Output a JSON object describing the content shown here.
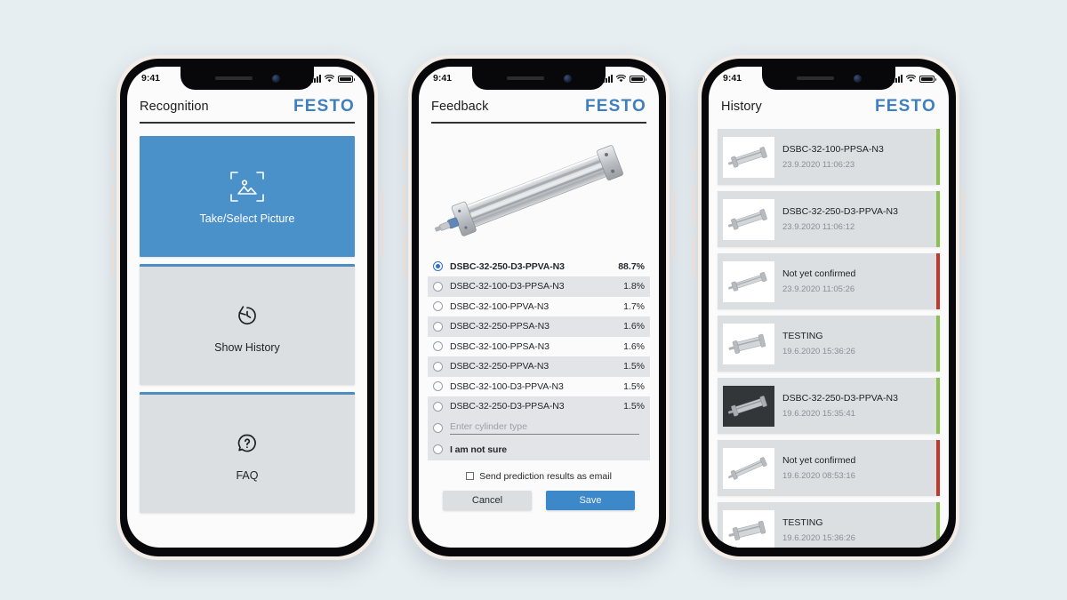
{
  "colors": {
    "background": "#e7eef2",
    "brand_blue": "#3f7fbf",
    "tile_blue": "#4a90c9",
    "tile_gray": "#dcdfe1",
    "save_blue": "#3d88c8",
    "status_ok": "#8cc152",
    "status_error": "#c0392b"
  },
  "status_bar": {
    "time": "9:41"
  },
  "brand": {
    "logo": "FESTO"
  },
  "screen_recognition": {
    "title": "Recognition",
    "tiles": [
      {
        "label": "Take/Select Picture",
        "icon": "image-scan-icon"
      },
      {
        "label": "Show History",
        "icon": "history-clock-icon"
      },
      {
        "label": "FAQ",
        "icon": "question-bubble-icon"
      }
    ]
  },
  "screen_feedback": {
    "title": "Feedback",
    "hero_image_alt": "pneumatic-cylinder-photo",
    "predictions": [
      {
        "name": "DSBC-32-250-D3-PPVA-N3",
        "confidence": "88.7%",
        "selected": true
      },
      {
        "name": "DSBC-32-100-D3-PPSA-N3",
        "confidence": "1.8%",
        "selected": false
      },
      {
        "name": "DSBC-32-100-PPVA-N3",
        "confidence": "1.7%",
        "selected": false
      },
      {
        "name": "DSBC-32-250-PPSA-N3",
        "confidence": "1.6%",
        "selected": false
      },
      {
        "name": "DSBC-32-100-PPSA-N3",
        "confidence": "1.6%",
        "selected": false
      },
      {
        "name": "DSBC-32-250-PPVA-N3",
        "confidence": "1.5%",
        "selected": false
      },
      {
        "name": "DSBC-32-100-D3-PPVA-N3",
        "confidence": "1.5%",
        "selected": false
      },
      {
        "name": "DSBC-32-250-D3-PPSA-N3",
        "confidence": "1.5%",
        "selected": false
      }
    ],
    "custom_entry": {
      "placeholder": "Enter cylinder type",
      "value": ""
    },
    "not_sure_label": "I am not sure",
    "email_checkbox": {
      "label": "Send prediction results as email",
      "checked": false
    },
    "cancel_label": "Cancel",
    "save_label": "Save"
  },
  "screen_history": {
    "title": "History",
    "items": [
      {
        "title": "DSBC-32-100-PPSA-N3",
        "date": "23.9.2020 11:06:23",
        "status": "ok",
        "thumb": "light"
      },
      {
        "title": "DSBC-32-250-D3-PPVA-N3",
        "date": "23.9.2020 11:06:12",
        "status": "ok",
        "thumb": "light"
      },
      {
        "title": "Not yet confirmed",
        "date": "23.9.2020 11:05:26",
        "status": "error",
        "thumb": "light"
      },
      {
        "title": "TESTING",
        "date": "19.6.2020 15:36:26",
        "status": "ok",
        "thumb": "light"
      },
      {
        "title": "DSBC-32-250-D3-PPVA-N3",
        "date": "19.6.2020 15:35:41",
        "status": "ok",
        "thumb": "dark"
      },
      {
        "title": "Not yet confirmed",
        "date": "19.6.2020 08:53:16",
        "status": "error",
        "thumb": "light"
      },
      {
        "title": "TESTING",
        "date": "19.6.2020 15:36:26",
        "status": "ok",
        "thumb": "light"
      }
    ]
  }
}
